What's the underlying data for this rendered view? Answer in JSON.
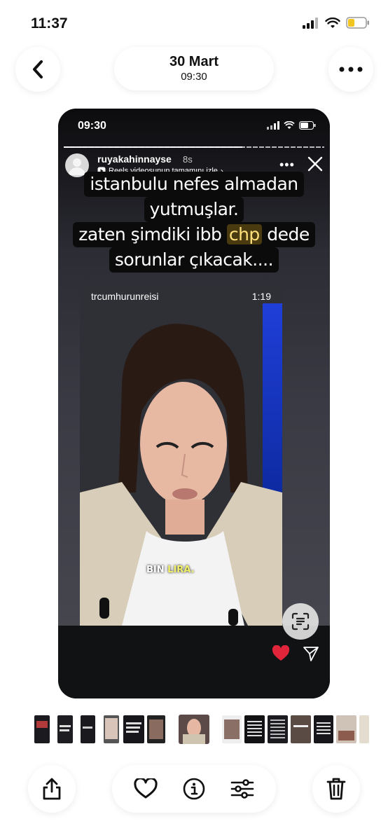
{
  "status_bar": {
    "time": "11:37"
  },
  "header": {
    "date": "30 Mart",
    "time": "09:30"
  },
  "screenshot": {
    "status_time": "09:30",
    "story": {
      "username": "ruyakahinnayse",
      "time_ago": "8s",
      "reels_link": "Reels videosunun tamamını izle",
      "caption_lines": [
        "istanbulu nefes almadan",
        "yutmuşlar.",
        "zaten şimdiki ibb",
        "chp",
        "dede",
        "sorunlar çıkacak...."
      ]
    },
    "reel": {
      "username": "trcumhurunreisi",
      "duration": "1:19",
      "subtitle_a": "BIN",
      "subtitle_b": "LIRA."
    }
  },
  "colors": {
    "accent_red": "#e0243a",
    "highlight": "#ffe07a"
  },
  "toolbar": [
    "share-icon",
    "heart-icon",
    "info-icon",
    "adjust-icon",
    "trash-icon"
  ]
}
